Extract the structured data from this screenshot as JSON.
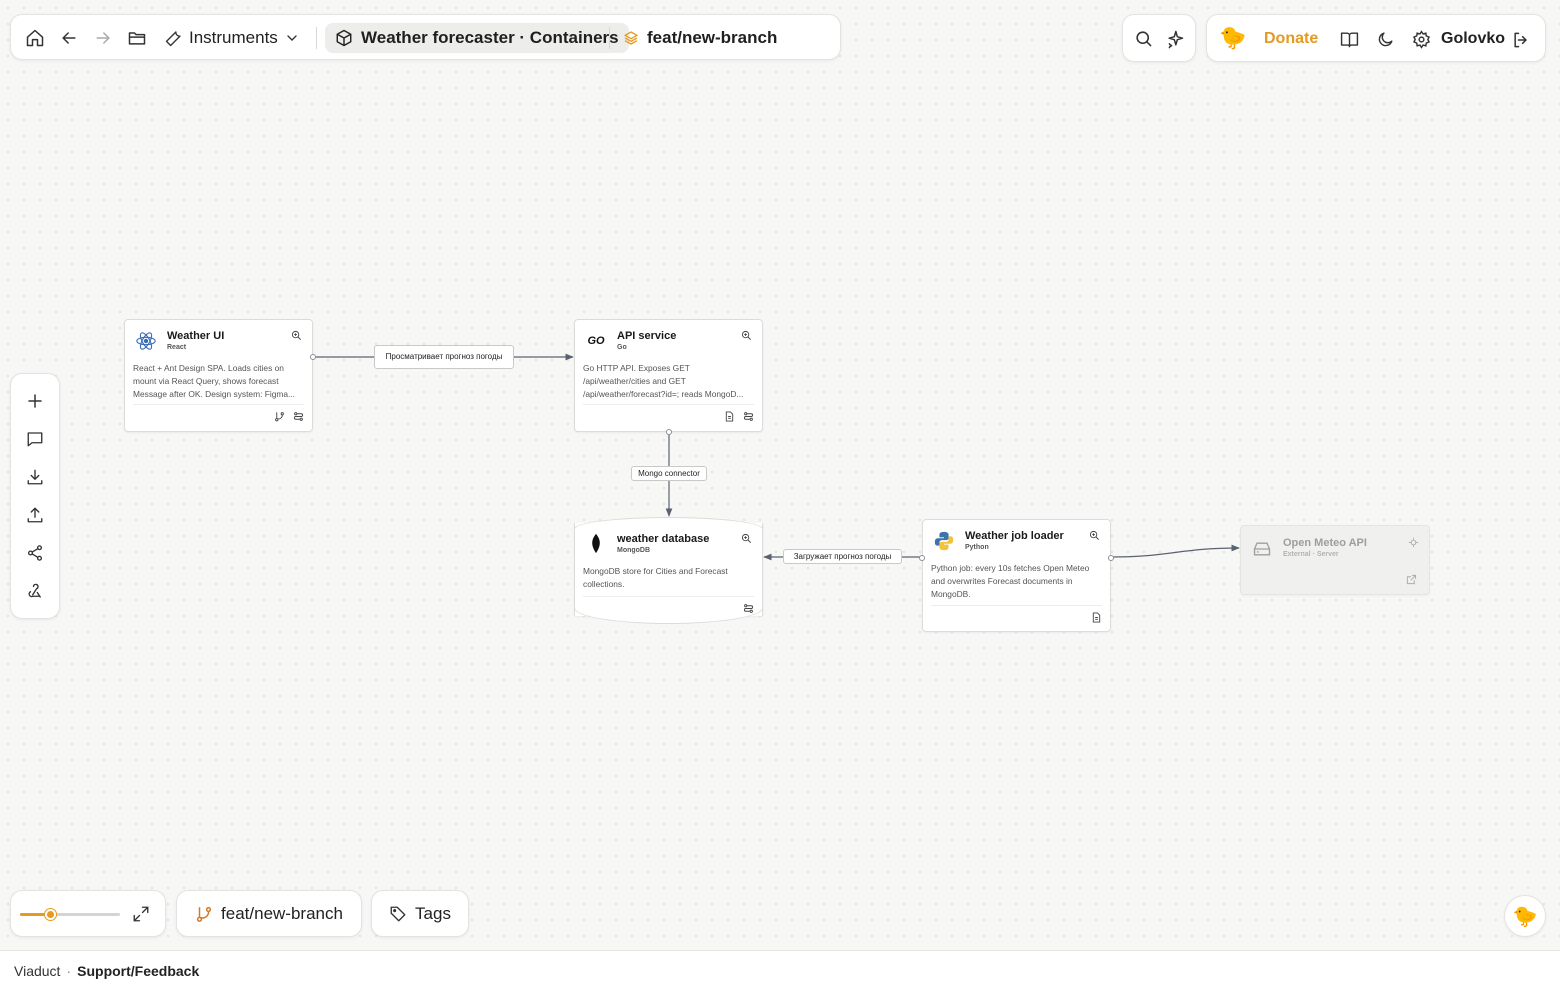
{
  "topbar": {
    "instruments_label": "Instruments",
    "breadcrumb": "Weather forecaster · Containers",
    "branch": "feat/new-branch"
  },
  "userbar": {
    "donate_label": "Donate",
    "username": "Golovko"
  },
  "canvas": {
    "nodes": {
      "weather_ui": {
        "title": "Weather UI",
        "tech": "React",
        "description": "React + Ant Design SPA. Loads cities on mount via React Query, shows forecast Message after OK. Design system: Figma..."
      },
      "api_service": {
        "title": "API service",
        "tech": "Go",
        "description": "Go HTTP API. Exposes GET /api/weather/cities and GET /api/weather/forecast?id=; reads MongoD..."
      },
      "weather_database": {
        "title": "weather database",
        "tech": "MongoDB",
        "description": "MongoDB store for Cities and Forecast collections."
      },
      "weather_job_loader": {
        "title": "Weather job loader",
        "tech": "Python",
        "description": "Python job: every 10s fetches Open Meteo and overwrites Forecast documents in MongoDB."
      },
      "open_meteo": {
        "title": "Open Meteo API",
        "tech": "External · Server"
      }
    },
    "edges": {
      "ui_to_api": "Просматривает прогноз погоды",
      "api_to_db": "Mongo connector",
      "loader_to_db": "Загружает прогноз погоды"
    }
  },
  "bottom": {
    "zoom_level": 0.3,
    "branch_label": "feat/new-branch",
    "tags_label": "Tags"
  },
  "footer": {
    "app_name": "Viaduct",
    "separator": "·",
    "support_link": "Support/Feedback"
  },
  "colors": {
    "accent": "#e59a22",
    "edge": "#6b7280"
  }
}
